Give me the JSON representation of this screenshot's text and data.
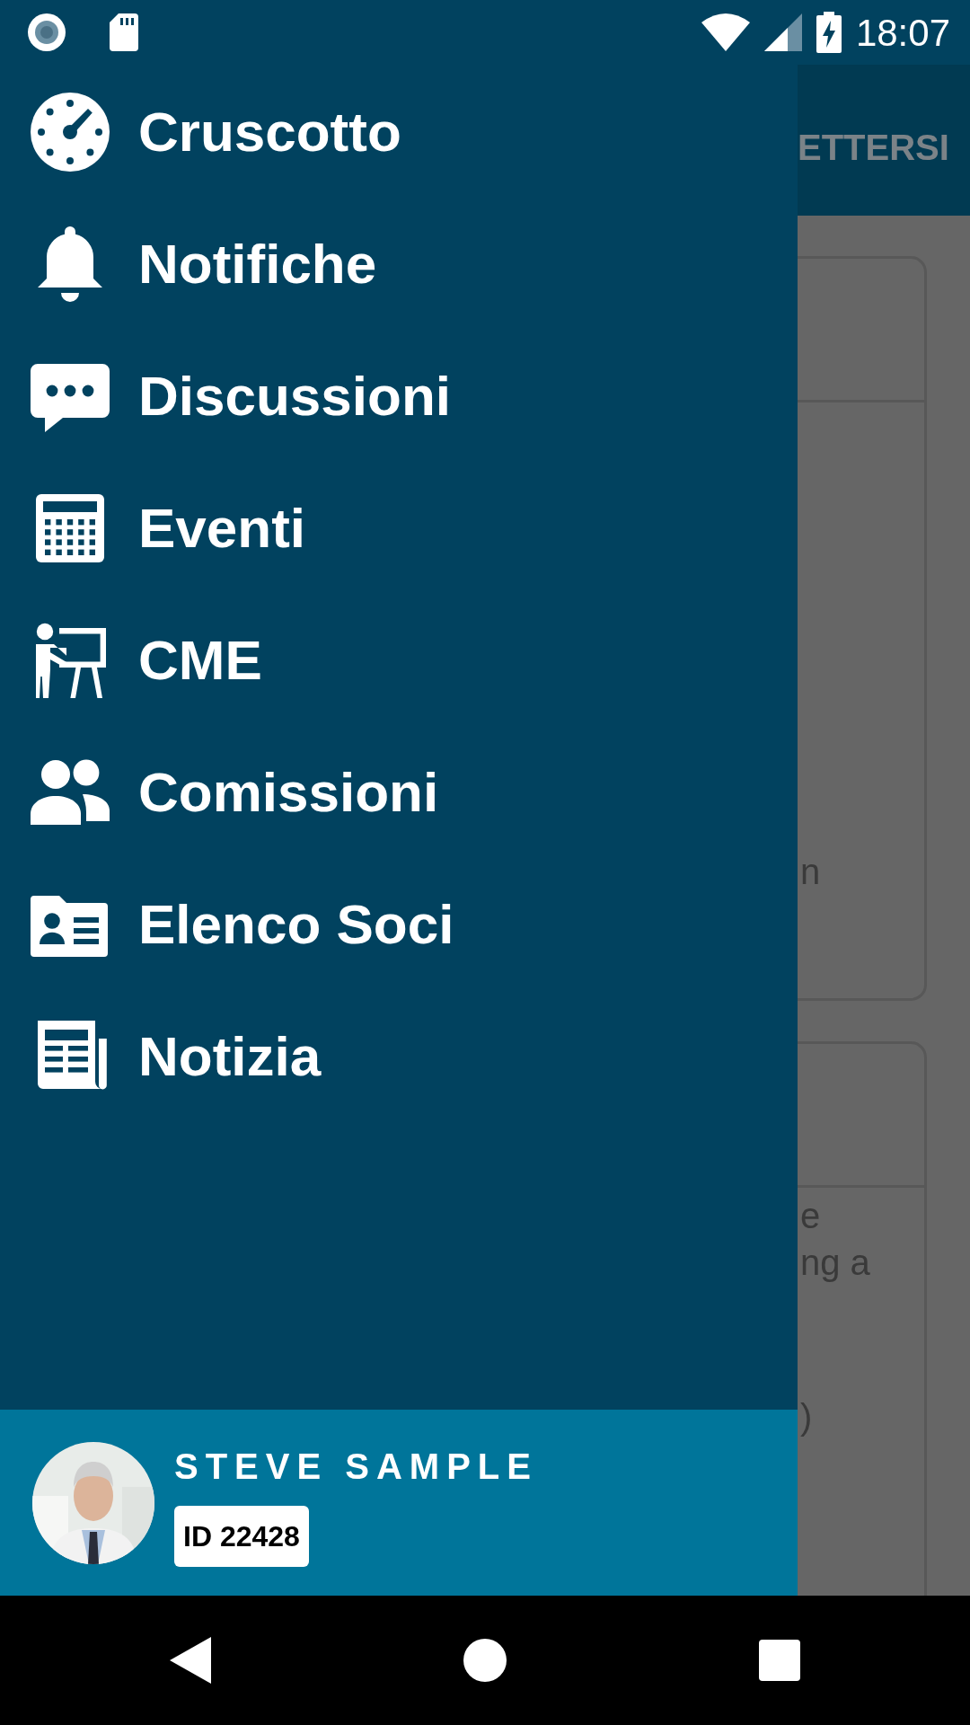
{
  "status_bar": {
    "time": "18:07"
  },
  "background": {
    "app_bar_text": "ETTERSI",
    "cards": [
      {
        "texts": [
          "n"
        ]
      },
      {
        "texts": [
          "e",
          "ng a",
          ")"
        ]
      }
    ]
  },
  "menu": [
    {
      "label": "Cruscotto"
    },
    {
      "label": "Notifiche"
    },
    {
      "label": "Discussioni"
    },
    {
      "label": "Eventi"
    },
    {
      "label": "CME"
    },
    {
      "label": "Comissioni"
    },
    {
      "label": "Elenco Soci"
    },
    {
      "label": "Notizia"
    }
  ],
  "user": {
    "name": "STEVE SAMPLE",
    "id_badge": "ID 22428"
  }
}
